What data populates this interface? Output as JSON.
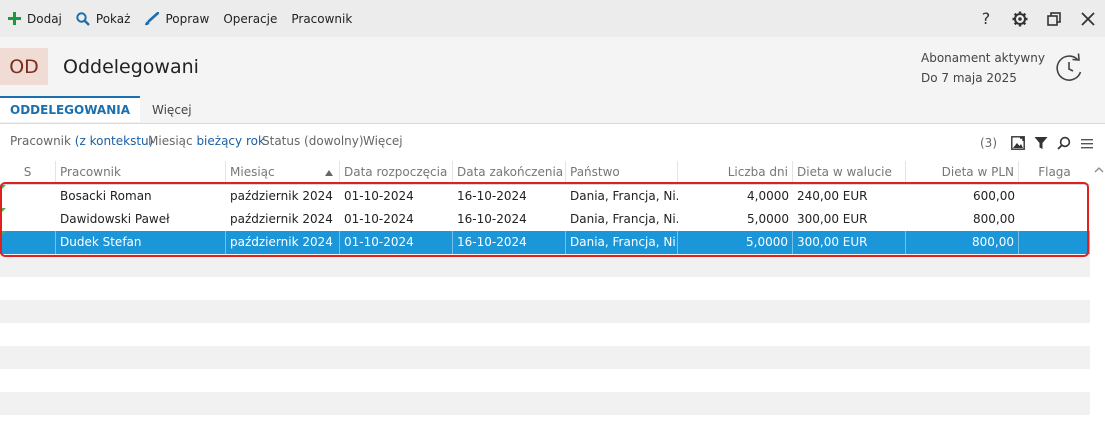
{
  "toolbar": {
    "add_label": "Dodaj",
    "show_label": "Pokaż",
    "edit_label": "Popraw",
    "operations_label": "Operacje",
    "employee_label": "Pracownik",
    "help_label": "?"
  },
  "header": {
    "badge": "OD",
    "title": "Oddelegowani",
    "subscription": "Abonament aktywny",
    "valid_until": "Do 7 maja 2025"
  },
  "tabs": {
    "active": "ODDELEGOWANIA",
    "more": "Więcej"
  },
  "filters": {
    "employee_label": "Pracownik",
    "employee_value": "(z kontekstu)",
    "month_label": "Miesiąc",
    "month_value": "bieżący rok",
    "status": "Status (dowolny)",
    "more": "Więcej",
    "count": "(3)"
  },
  "grid": {
    "headers": {
      "s": "S",
      "employee": "Pracownik",
      "month": "Miesiąc",
      "start": "Data rozpoczęcia",
      "end": "Data zakończenia",
      "country": "Państwo",
      "days": "Liczba dni",
      "diet_currency": "Dieta w walucie",
      "diet_pln": "Dieta w PLN",
      "flag": "Flaga"
    },
    "rows": [
      {
        "employee": "Bosacki Roman",
        "month": "październik 2024",
        "start": "01-10-2024",
        "end": "16-10-2024",
        "country": "Dania, Francja, Ni...",
        "days": "4,0000",
        "diet_currency": "240,00 EUR",
        "diet_pln": "600,00",
        "flag": ""
      },
      {
        "employee": "Dawidowski Paweł",
        "month": "październik 2024",
        "start": "01-10-2024",
        "end": "16-10-2024",
        "country": "Dania, Francja, Ni...",
        "days": "5,0000",
        "diet_currency": "300,00 EUR",
        "diet_pln": "800,00",
        "flag": ""
      },
      {
        "employee": "Dudek Stefan",
        "month": "październik 2024",
        "start": "01-10-2024",
        "end": "16-10-2024",
        "country": "Dania, Francja, Ni...",
        "days": "5,0000",
        "diet_currency": "300,00 EUR",
        "diet_pln": "800,00",
        "flag": ""
      }
    ]
  },
  "colors": {
    "accent": "#1b6fae",
    "selection": "#1b96d9",
    "highlight_border": "#e0201f",
    "add_icon": "#1a9a3c",
    "badge_bg": "#f0dcd4"
  }
}
